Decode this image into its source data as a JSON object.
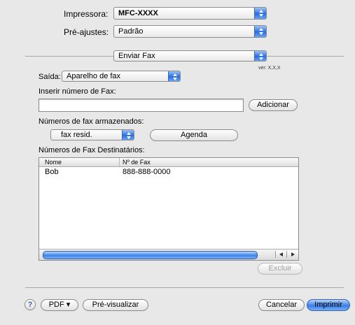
{
  "printer": {
    "label": "Impressora:",
    "value": "MFC-XXXX"
  },
  "presets": {
    "label": "Pré-ajustes:",
    "value": "Padrão"
  },
  "panel": {
    "value": "Enviar Fax"
  },
  "version": "ver: X,X,X",
  "output": {
    "label": "Saída:",
    "value": "Aparelho de fax"
  },
  "fax_entry": {
    "label": "Inserir número de Fax:",
    "value": "",
    "add_button": "Adicionar"
  },
  "stored": {
    "label": "Números de fax armazenados:",
    "value": "fax resid.",
    "agenda_button": "Agenda"
  },
  "recipients": {
    "label": "Números de Fax Destinatários:",
    "columns": [
      "Nome",
      "Nº de Fax"
    ],
    "rows": [
      {
        "name": "Bob",
        "fax": "888-888-0000"
      }
    ],
    "delete_button": "Excluir"
  },
  "footer": {
    "help": "?",
    "pdf_button": "PDF ▾",
    "preview_button": "Pré-visualizar",
    "cancel_button": "Cancelar",
    "print_button": "Imprimir"
  },
  "colors": {
    "accent": "#2a6de0",
    "background": "#e8e8e8"
  }
}
